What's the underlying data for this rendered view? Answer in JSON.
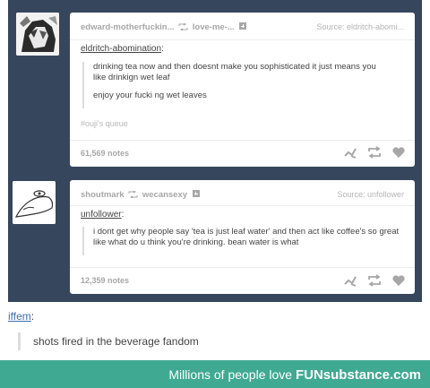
{
  "posts": [
    {
      "header": {
        "author": "edward-motherfuckin...",
        "reblogged_from": "love-me-...",
        "source": "Source: eldritch-abomi..."
      },
      "reblog_user": "eldritch-abomination",
      "quote_lines": [
        "drinking tea now and then doesnt make you sophisticated it just means you like drinkign wet leaf",
        "enjoy your fucki ng wet leaves"
      ],
      "tag": "#ouji's queue",
      "notes": "61,569 notes"
    },
    {
      "header": {
        "author": "shoutmark",
        "reblogged_from": "wecansexy",
        "source": "Source: unfollower"
      },
      "reblog_user": "unfollower",
      "quote_lines": [
        "i dont get why people say 'tea is just leaf water' and then act like coffee's so great like what do u think you're drinking. bean water is what"
      ],
      "notes": "12,359 notes"
    }
  ],
  "op": {
    "user": "iffem",
    "text": "shots fired in the beverage fandom"
  },
  "footer": {
    "text": "Millions of people love",
    "brand": "FUNsubstance.com"
  },
  "icons": [
    "reblog-icon",
    "follow-icon",
    "share-icon",
    "like-icon",
    "avatar-anime-icon",
    "avatar-drawing-icon"
  ],
  "colors": {
    "dashboard": "#36465d",
    "footer": "#40a992",
    "link": "#3d6fb3"
  }
}
